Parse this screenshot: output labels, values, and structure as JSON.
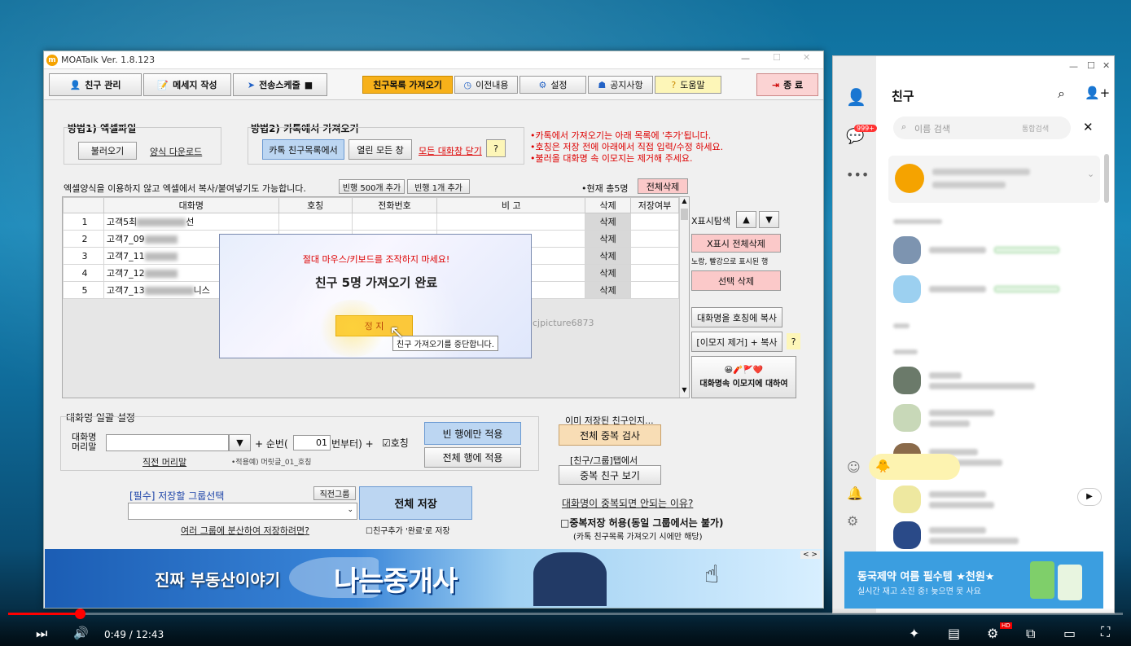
{
  "app": {
    "title": "MOATalk Ver. 1.8.123",
    "watermark": "cjpicture6873"
  },
  "toolbar": {
    "friend_mgmt": "친구 관리",
    "msg_write": "메세지 작성",
    "send_schedule": "전송스케줄",
    "fetch_friends": "친구목록 가져오기",
    "history": "이전내용",
    "settings": "설정",
    "notice": "공지사항",
    "help": "도움말",
    "exit": "종 료"
  },
  "method1": {
    "title": "방법1) 엑셀파일",
    "load": "불러오기",
    "template": "양식 다운로드"
  },
  "method2": {
    "title": "방법2) 카톡에서 가져오기",
    "kakao_list": "카톡 친구목록에서",
    "open_all": "열린 모든 창",
    "close_all": "모든 대화창 닫기",
    "q": "?"
  },
  "notes": [
    "•카톡에서 가져오기는 아래 목록에 '추가'됩니다.",
    "•호칭은 저장 전에 아래에서 직접 입력/수정 하세요.",
    "•불러올 대화명 속 이모지는 제거해 주세요."
  ],
  "grid_bar": {
    "hint": "엑셀양식을 이용하지 않고 엑셀에서 복사/붙여넣기도 가능합니다.",
    "add500": "빈행 500개 추가",
    "add1": "빈행 1개 추가",
    "total": "•현재 총5명",
    "delete_all": "전체삭제"
  },
  "table": {
    "headers": [
      "대화명",
      "호칭",
      "전화번호",
      "비 고",
      "삭제",
      "저장여부"
    ],
    "rows": [
      {
        "no": "1",
        "name": "고객5최",
        "tail": "선",
        "del": "삭제"
      },
      {
        "no": "2",
        "name": "고객7_09",
        "tail": "",
        "del": "삭제"
      },
      {
        "no": "3",
        "name": "고객7_11",
        "tail": "",
        "del": "삭제"
      },
      {
        "no": "4",
        "name": "고객7_12",
        "tail": "",
        "del": "삭제"
      },
      {
        "no": "5",
        "name": "고객7_13",
        "tail": "니스",
        "del": "삭제"
      }
    ]
  },
  "right_panel": {
    "x_search": "X표시탐색",
    "x_delete_all": "X표시 전체삭제",
    "x_note": "노랑, 빨강으로 표시된 행",
    "sel_delete": "선택 삭제",
    "copy_name": "대화명을 호칭에 복사",
    "emoji_copy": "[이모지 제거] + 복사",
    "q": "?",
    "emoji_about": "대화명속 이모지에 대하여",
    "emoji_icons": "😀🧨🚩❤️"
  },
  "dialog": {
    "warning": "절대 마우스/키보드를 조작하지 마세요!",
    "status": "친구 5명 가져오기 완료",
    "stop": "정 지",
    "tooltip": "친구 가져오기를 중단합니다."
  },
  "bulk": {
    "title": "대화명 일괄 설정",
    "label": "대화명\n머리말",
    "seq_label": "+ 순번(",
    "seq_value": "01",
    "seq_tail": "번부터) +",
    "honor": "호칭",
    "recent": "직전 머리말",
    "example": "•적용예) 머릿글_01_호칭",
    "apply_empty": "빈 행에만 적용",
    "apply_all": "전체 행에 적용"
  },
  "dup": {
    "already": "이미 저장된 친구인지...",
    "check_all": "전체 중복 검사",
    "tab_label": "[친구/그룹]탭에서",
    "view_dup": "중복 친구 보기",
    "why": "대화명이 중복되면 안되는 이유?",
    "allow_dup": "□중복저장 허용(동일 그룹에서는 불가)",
    "allow_note": "(카톡 친구목록 가져오기 시에만 해당)"
  },
  "save": {
    "group_label": "[필수] 저장할 그룹선택",
    "recent_group": "직전그룹",
    "save_all": "전체 저장",
    "multi_group": "여러 그룹에 분산하여 저장하려면?",
    "complete_save": "친구추가 '완료'로 저장"
  },
  "banner": {
    "left": "진짜 부동산이야기",
    "main": "나는중개사",
    "nav": "< >"
  },
  "kakao": {
    "title": "친구",
    "search_placeholder": "이름 검색",
    "search_hint": "통합검색",
    "badge": "999+",
    "ad_title": "동국제약 여름 필수템 ★천원★",
    "ad_sub": "실시간 재고 소진 중! 늦으면 못 사요"
  },
  "player": {
    "time": "0:49 / 12:43",
    "progress": 0.064,
    "hd": "HD"
  },
  "colors": {
    "accent_orange": "#f5b400",
    "red_text": "#d40000",
    "blue_btn": "#bcd6f2",
    "kakao_yellow": "#fee500"
  }
}
